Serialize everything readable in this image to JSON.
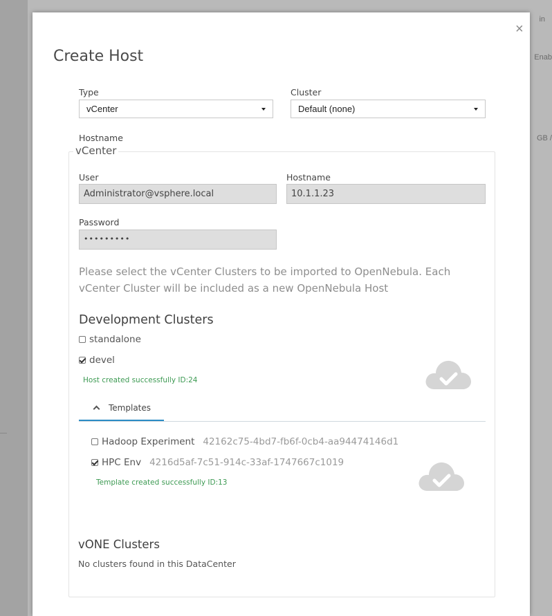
{
  "background": {
    "fragments": [
      "in",
      "Enab",
      "GB /"
    ]
  },
  "dialog": {
    "title": "Create Host",
    "close_label": "×"
  },
  "form": {
    "type": {
      "label": "Type",
      "value": "vCenter"
    },
    "cluster": {
      "label": "Cluster",
      "value": "Default (none)"
    },
    "hostname_label": "Hostname",
    "vcenter_legend": "vCenter",
    "user": {
      "label": "User",
      "value": "Administrator@vsphere.local"
    },
    "vc_hostname": {
      "label": "Hostname",
      "value": "10.1.1.23"
    },
    "password": {
      "label": "Password",
      "value": "•••••••••"
    }
  },
  "info_text": "Please select the vCenter Clusters to be imported to OpenNebula. Each vCenter Cluster will be included as a new OpenNebula Host",
  "datacenters": [
    {
      "title": "Development Clusters",
      "clusters": [
        {
          "name": "standalone",
          "checked": false
        },
        {
          "name": "devel",
          "checked": true
        }
      ],
      "host_status": "Host created successfully ID:24",
      "tab_label": "Templates",
      "templates": [
        {
          "name": "Hadoop Experiment",
          "uuid": "42162c75-4bd7-fb6f-0cb4-aa94474146d1",
          "checked": false
        },
        {
          "name": "HPC Env",
          "uuid": "4216d5af-7c51-914c-33af-1747667c1019",
          "checked": true
        }
      ],
      "template_status": "Template created successfully ID:13"
    },
    {
      "title": "vONE Clusters",
      "empty_text": "No clusters found in this DataCenter"
    }
  ],
  "icons": {
    "success_cloud": "cloud-check-icon",
    "tab_chevron": "chevron-up-icon",
    "close": "close-icon"
  },
  "colors": {
    "success_text": "#3d9a53",
    "tab_accent": "#2a8bc4",
    "cloud_icon": "#d5d5d5"
  }
}
